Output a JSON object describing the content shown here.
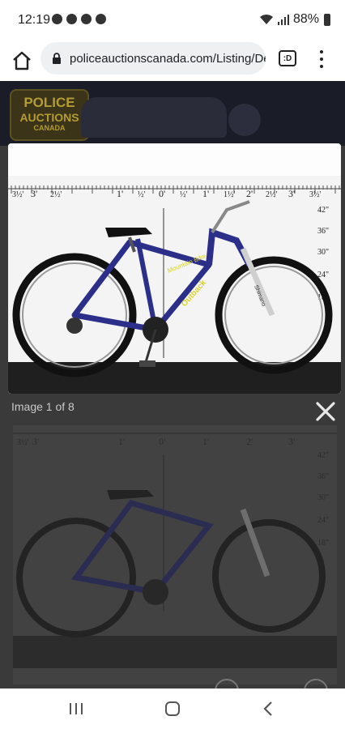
{
  "status_bar": {
    "time": "12:19",
    "battery": "88%",
    "notification_icons": [
      "snapchat-icon",
      "slack-icon",
      "leaf-icon",
      "leaf-icon"
    ]
  },
  "browser": {
    "url": "policeauctionscanada.com/Listing/Deta",
    "tab_label": ":D",
    "home_icon": "home-icon",
    "lock_icon": "lock-icon",
    "menu_icon": "more-vert-icon"
  },
  "header": {
    "logo_line1": "POLICE",
    "logo_line2": "AUCTIONS",
    "logo_line3": "CANADA"
  },
  "ruler": {
    "top_labels": [
      "3½'",
      "3'",
      "2½'",
      "1'",
      "½'",
      "0'",
      "½'",
      "1'",
      "1½'",
      "2'",
      "2½'",
      "3'",
      "3½'"
    ],
    "side_labels": [
      "42\"",
      "36\"",
      "30\"",
      "24\"",
      "18\""
    ]
  },
  "bike": {
    "decal_top": "Mountain Bike",
    "decal_down": "Outback",
    "fork_text": "Shimano"
  },
  "viewer": {
    "caption": "Image 1 of 8",
    "close_icon": "close-icon"
  },
  "nav": {
    "recents": "recents-icon",
    "home": "home-circle-icon",
    "back": "back-icon"
  },
  "colors": {
    "frame": "#2c2f8a",
    "accent": "#d8d22c",
    "dim_overlay": "#3a3a3a"
  }
}
